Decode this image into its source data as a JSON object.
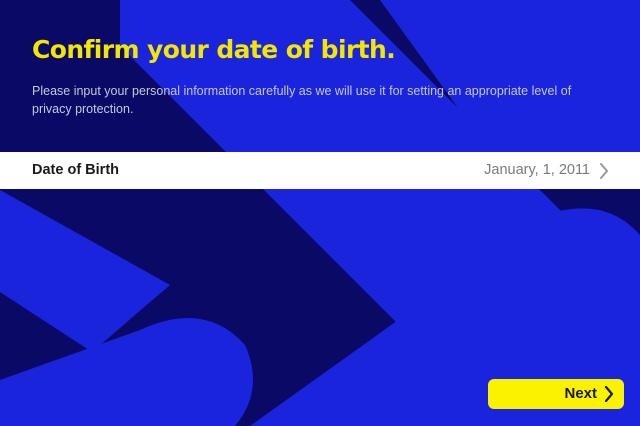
{
  "title": "Confirm your date of birth.",
  "description": "Please input your personal information carefully as we will use it for setting an appropriate level of privacy protection.",
  "date_of_birth": {
    "label": "Date of Birth",
    "value": "January, 1, 2011",
    "icon": "chevron-right-icon"
  },
  "next_button": {
    "label": "Next",
    "icon": "chevron-right-icon"
  },
  "colors": {
    "background": "#0a0a66",
    "pattern": "#1a24dd",
    "title": "#f3e600",
    "button": "#fbf200",
    "row": "#ffffff"
  }
}
